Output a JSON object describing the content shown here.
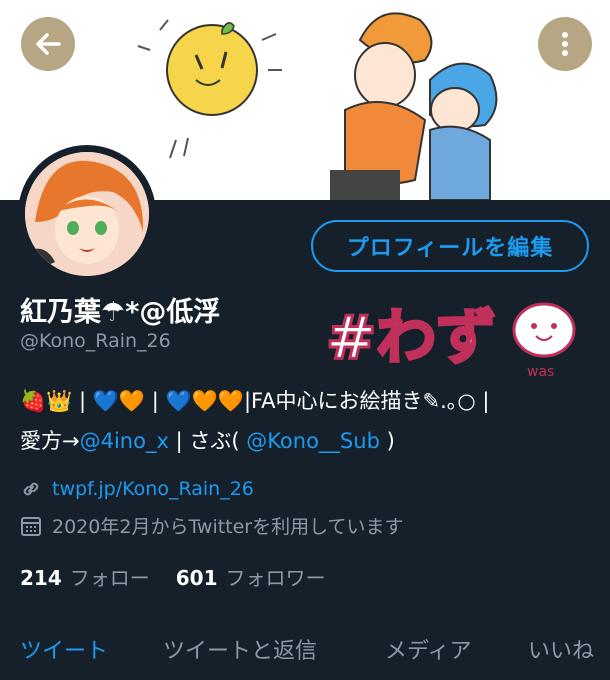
{
  "header": {
    "back_icon": "arrow-left-icon",
    "more_icon": "more-vertical-icon"
  },
  "profile": {
    "edit_label": "プロフィールを編集",
    "display_name": "紅乃葉☂*@低浮",
    "handle": "@Kono_Rain_26",
    "name_image_text": "#わず",
    "name_image_sub": "was"
  },
  "bio": {
    "line1_emoji": "🍓👑",
    "line1_sep1": "|",
    "line1_hearts1": "💙🧡",
    "line1_sep2": "|",
    "line1_hearts2": "💙🧡🧡",
    "line1_text": "|FA中心にお絵描き✎.｡○ |",
    "line2_prefix": "愛方→",
    "line2_link1": "@4ino_x",
    "line2_mid": " | さぶ(",
    "line2_link2": "@Kono__Sub",
    "line2_suffix": " )"
  },
  "meta": {
    "url": "twpf.jp/Kono_Rain_26",
    "joined": "2020年2月からTwitterを利用しています"
  },
  "stats": {
    "following_count": "214",
    "following_label": "フォロー",
    "followers_count": "601",
    "followers_label": "フォロワー"
  },
  "tabs": {
    "tweets": "ツイート",
    "replies": "ツイートと返信",
    "media": "メディア",
    "likes": "いいね"
  },
  "colors": {
    "background": "#15202b",
    "accent": "#1d9bf0",
    "muted": "#8b98a5"
  }
}
